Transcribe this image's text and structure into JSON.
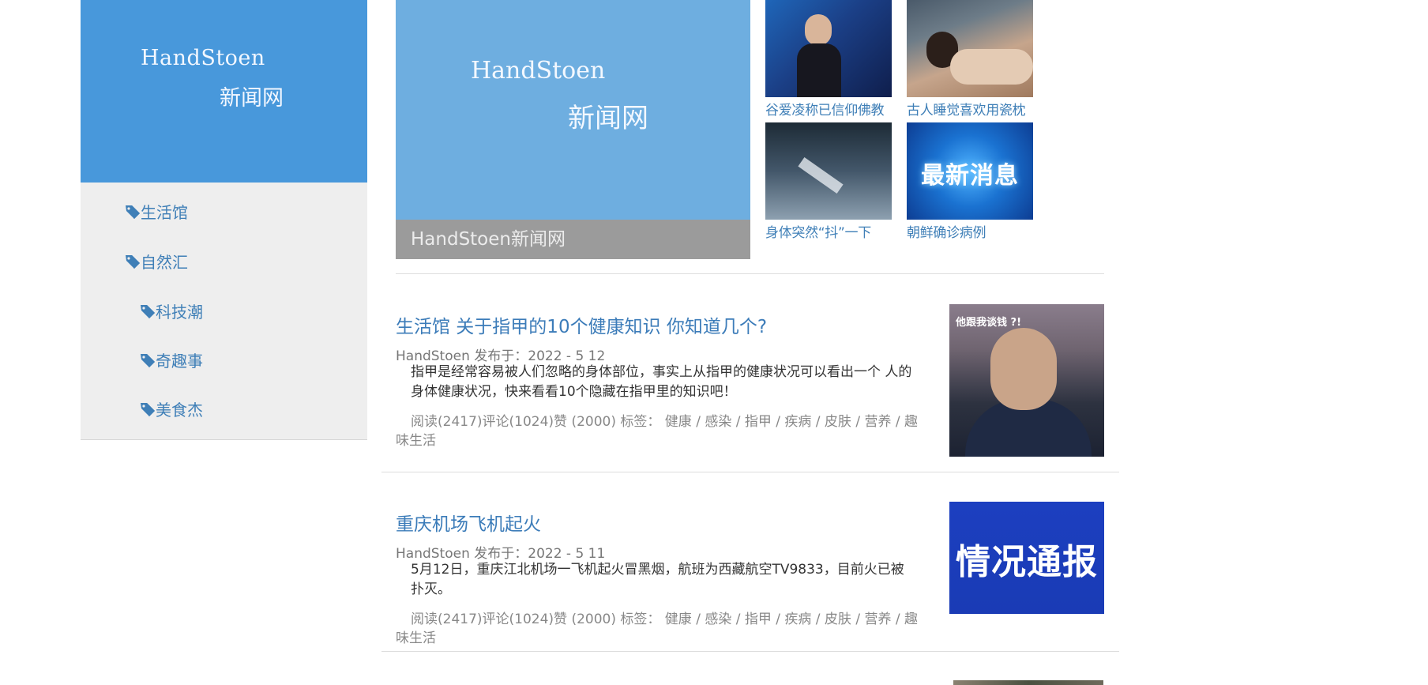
{
  "sidebar": {
    "logo": {
      "line1": "HandStoen",
      "line2": "新闻网"
    },
    "nav": [
      {
        "label": "生活馆",
        "icon": "tag-icon"
      },
      {
        "label": "自然汇",
        "icon": "tag-icon"
      },
      {
        "label": "科技潮",
        "icon": "tag-icon"
      },
      {
        "label": "奇趣事",
        "icon": "tag-icon"
      },
      {
        "label": "美食杰",
        "icon": "tag-icon"
      }
    ]
  },
  "featured": {
    "hero": {
      "line1": "HandStoen",
      "line2": "新闻网",
      "caption": "HandStoen新闻网"
    },
    "thumbs": [
      {
        "caption": "谷爱凌称已信仰佛教"
      },
      {
        "caption": "古人睡觉喜欢用瓷枕"
      },
      {
        "caption": "身体突然“抖”一下"
      },
      {
        "caption": "朝鲜确诊病例",
        "image_text": "最新消息"
      }
    ]
  },
  "articles": [
    {
      "title": "生活馆 关于指甲的10个健康知识 你知道几个?",
      "meta": "HandStoen 发布于：2022 - 5 12",
      "summary": "指甲是经常容易被人们忽略的身体部位，事实上从指甲的健康状况可以看出一个 人的身体健康状况，快来看看10个隐藏在指甲里的知识吧！",
      "stats": "阅读(2417)评论(1024)赞 (2000) 标签： 健康 / 感染 / 指甲 / 疾病 / 皮肤 / 营养 / 趣味生活",
      "image_text": "他跟我谈钱 ?!"
    },
    {
      "title": "重庆机场飞机起火",
      "meta": "HandStoen 发布于：2022 - 5 11",
      "summary": "5月12日，重庆江北机场一飞机起火冒黑烟，航班为西藏航空TV9833，目前火已被扑灭。",
      "stats": "阅读(2417)评论(1024)赞 (2000) 标签： 健康 / 感染 / 指甲 / 疾病 / 皮肤 / 营养 / 趣味生活",
      "image_text": "情况通报"
    }
  ],
  "colors": {
    "link": "#3f7fb7",
    "sidebar_logo_bg": "#4898db",
    "hero_bg": "#6eaee0",
    "nav_bg": "#eeeeee"
  }
}
